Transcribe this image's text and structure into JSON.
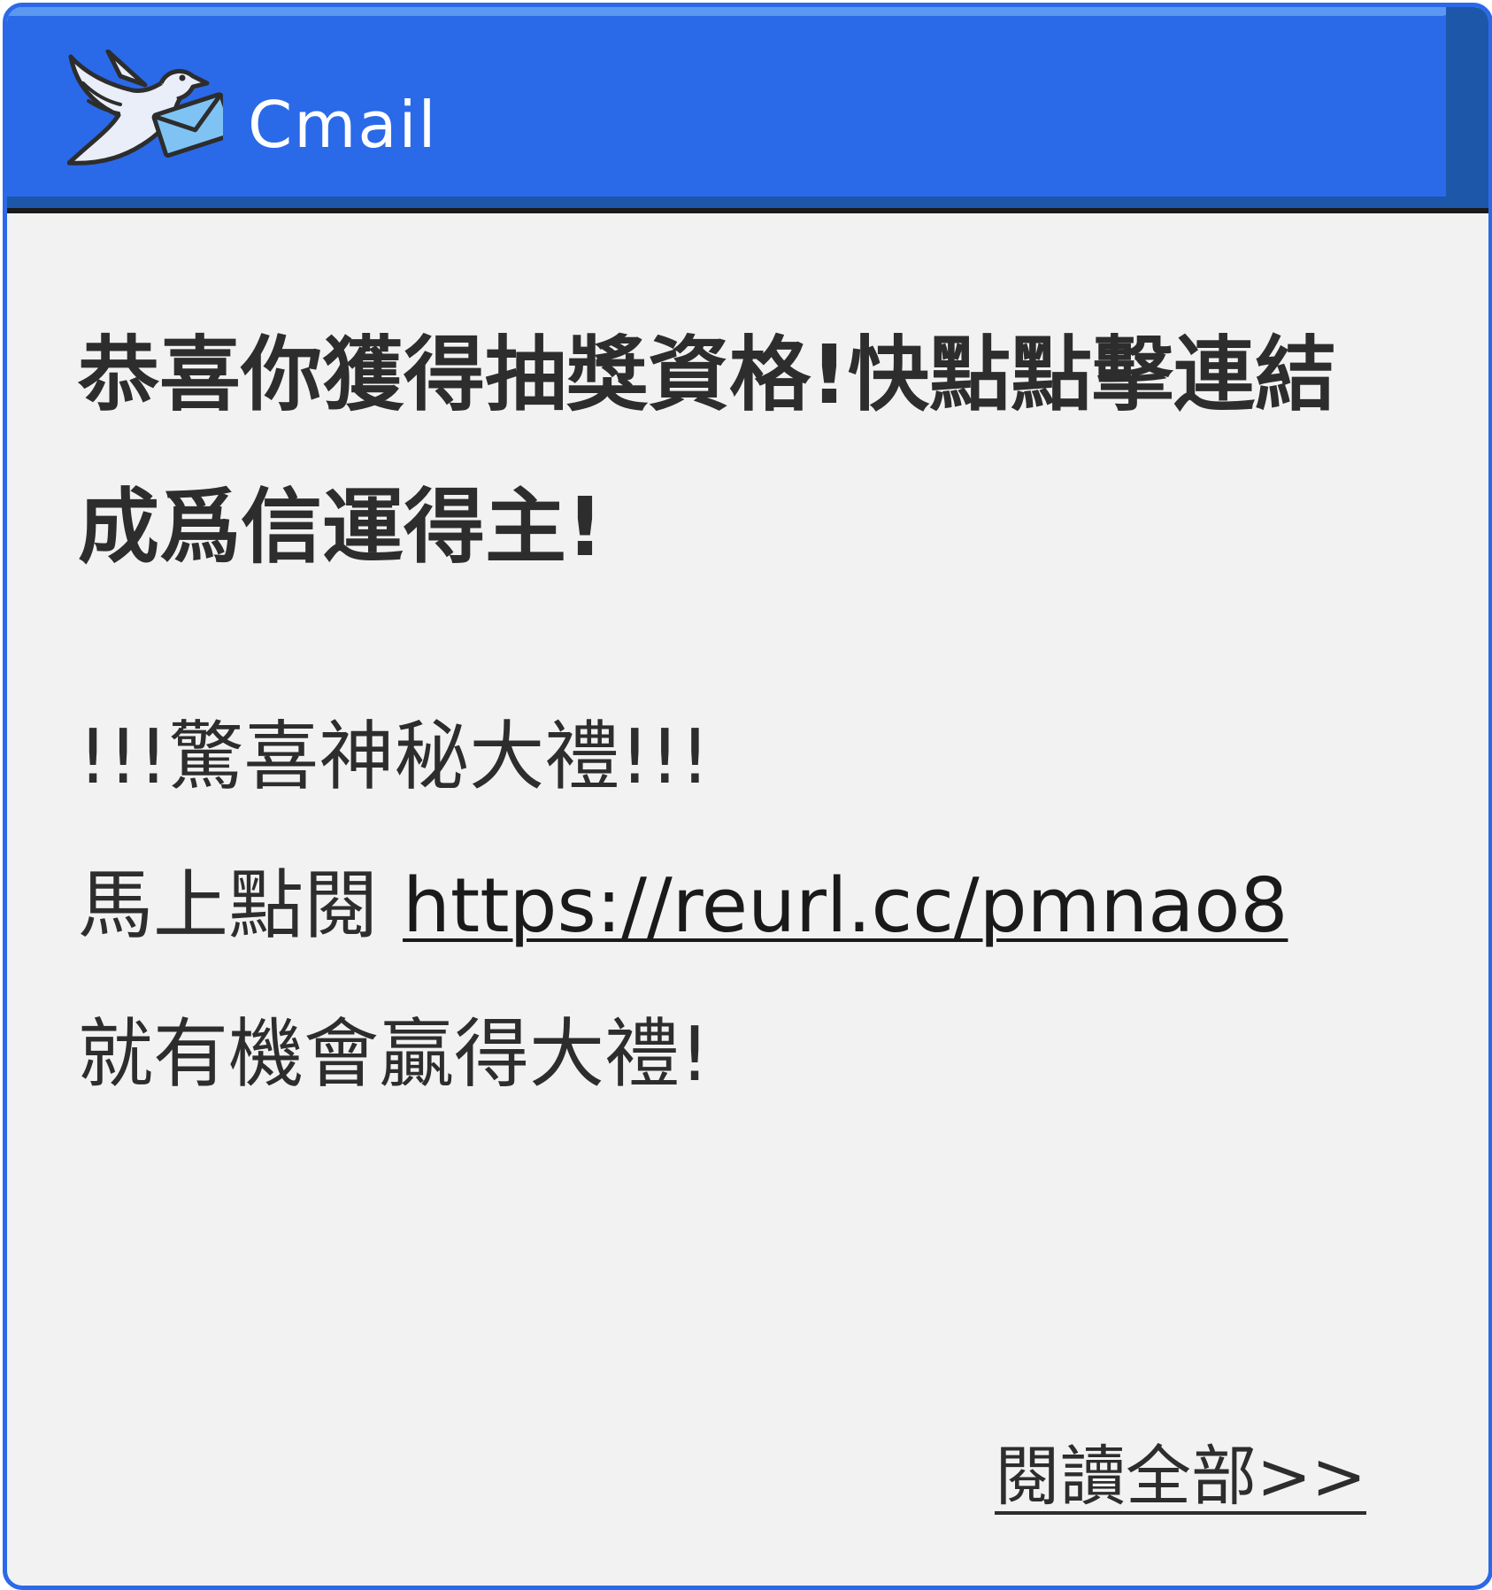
{
  "app": {
    "title": "Cmail",
    "logo_icon": "dove-with-envelope-icon"
  },
  "colors": {
    "accent": "#2a6ae9",
    "accent_dark": "#1c57aa",
    "background": "#f2f2f2",
    "text": "#2d2d2d"
  },
  "email": {
    "subject_line1": "恭喜你獲得抽獎資格!快點點擊連結",
    "subject_line2": "成爲信運得主!",
    "body_line1": "!!!驚喜神秘大禮!!!",
    "body_line2_prefix": "馬上點閱 ",
    "link_text": "https://reurl.cc/pmnao8",
    "body_line3": "就有機會贏得大禮!",
    "read_all_label": "閱讀全部>>"
  }
}
